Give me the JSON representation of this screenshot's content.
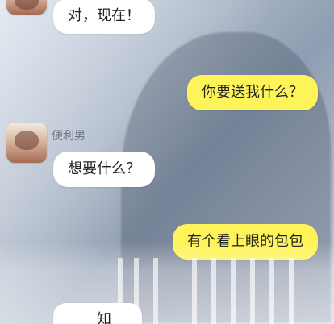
{
  "contact": {
    "name": "便利男"
  },
  "messages": [
    {
      "side": "left",
      "text": "对，现在！"
    },
    {
      "side": "right",
      "text": "你要送我什么？"
    },
    {
      "side": "left",
      "text": "想要什么？"
    },
    {
      "side": "right",
      "text": "有个看上眼的包包"
    }
  ],
  "partial_message": {
    "text": "知"
  },
  "colors": {
    "outgoing_bubble": "#fff35a",
    "incoming_bubble": "#ffffff"
  }
}
